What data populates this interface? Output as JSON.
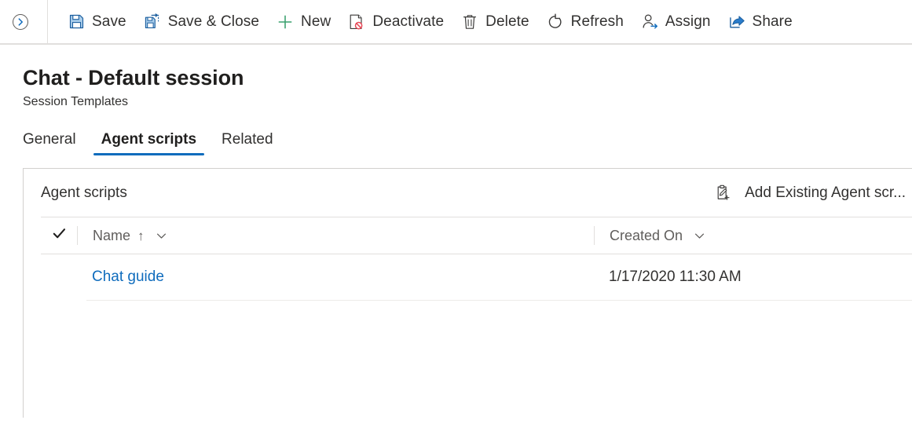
{
  "commandbar": {
    "back_icon": "chevron-right-circle-icon",
    "items": [
      {
        "id": "save",
        "label": "Save",
        "icon": "save-floppy-icon"
      },
      {
        "id": "save-close",
        "label": "Save & Close",
        "icon": "save-and-close-icon"
      },
      {
        "id": "new",
        "label": "New",
        "icon": "plus-icon"
      },
      {
        "id": "deactivate",
        "label": "Deactivate",
        "icon": "deactivate-page-blocked-icon"
      },
      {
        "id": "delete",
        "label": "Delete",
        "icon": "trash-icon"
      },
      {
        "id": "refresh",
        "label": "Refresh",
        "icon": "refresh-icon"
      },
      {
        "id": "assign",
        "label": "Assign",
        "icon": "assign-person-arrow-icon"
      },
      {
        "id": "share",
        "label": "Share",
        "icon": "share-arrow-icon"
      }
    ]
  },
  "header": {
    "title": "Chat - Default session",
    "subtitle": "Session Templates"
  },
  "tabs": [
    {
      "id": "general",
      "label": "General",
      "active": false
    },
    {
      "id": "agent-scripts",
      "label": "Agent scripts",
      "active": true
    },
    {
      "id": "related",
      "label": "Related",
      "active": false
    }
  ],
  "subgrid": {
    "title": "Agent scripts",
    "action": {
      "label": "Add Existing Agent scr...",
      "icon": "add-existing-clipboard-icon"
    },
    "columns": [
      {
        "id": "name",
        "label": "Name",
        "sort": "ascending",
        "sort_glyph": "↑"
      },
      {
        "id": "created-on",
        "label": "Created On",
        "sort": "none"
      }
    ],
    "select_all_icon": "checkmark-icon",
    "rows": [
      {
        "name": "Chat guide",
        "created_on": "1/17/2020 11:30 AM"
      }
    ]
  },
  "colors": {
    "accent": "#0f6cbd",
    "link": "#0f6cbd",
    "text": "#201f1e",
    "muted": "#605e5c",
    "border": "#e1dfdd",
    "new_icon_green": "#3aa06e",
    "deactivate_red": "#e74856"
  }
}
